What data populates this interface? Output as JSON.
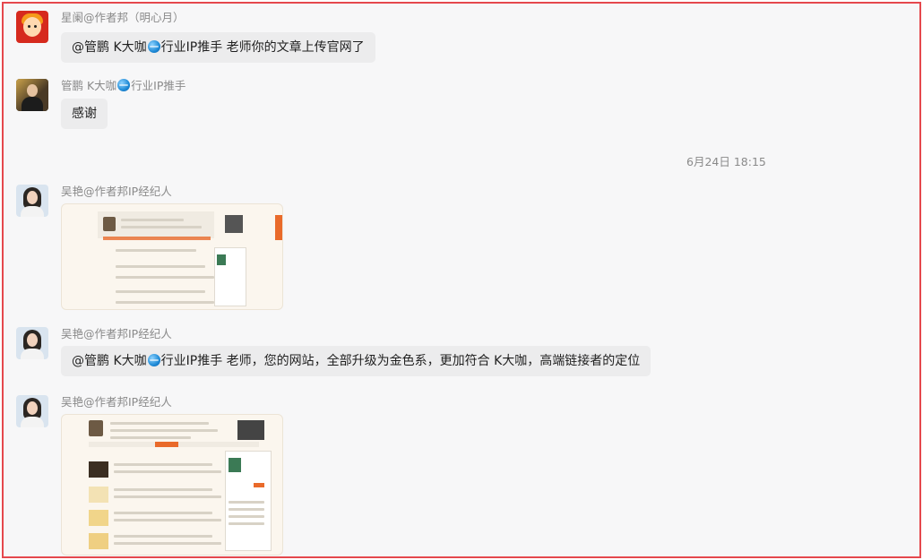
{
  "chat": {
    "messages": [
      {
        "sender": "星阑@作者邦（明心月）",
        "text_prefix": "@管鹏 K大咖",
        "text_suffix": "行业IP推手 老师你的文章上传官网了"
      },
      {
        "sender_prefix": "管鹏 K大咖",
        "sender_suffix": "行业IP推手",
        "text": "感谢"
      },
      {
        "sender": "吴艳@作者邦IP经纪人",
        "image": "website-screenshot"
      },
      {
        "sender": "吴艳@作者邦IP经纪人",
        "text_prefix": "@管鹏 K大咖",
        "text_suffix": "行业IP推手 老师，您的网站，全部升级为金色系，更加符合 K大咖，高端链接者的定位"
      },
      {
        "sender": "吴艳@作者邦IP经纪人",
        "image": "website-screenshot"
      }
    ],
    "timestamp": "6月24日 18:15"
  }
}
